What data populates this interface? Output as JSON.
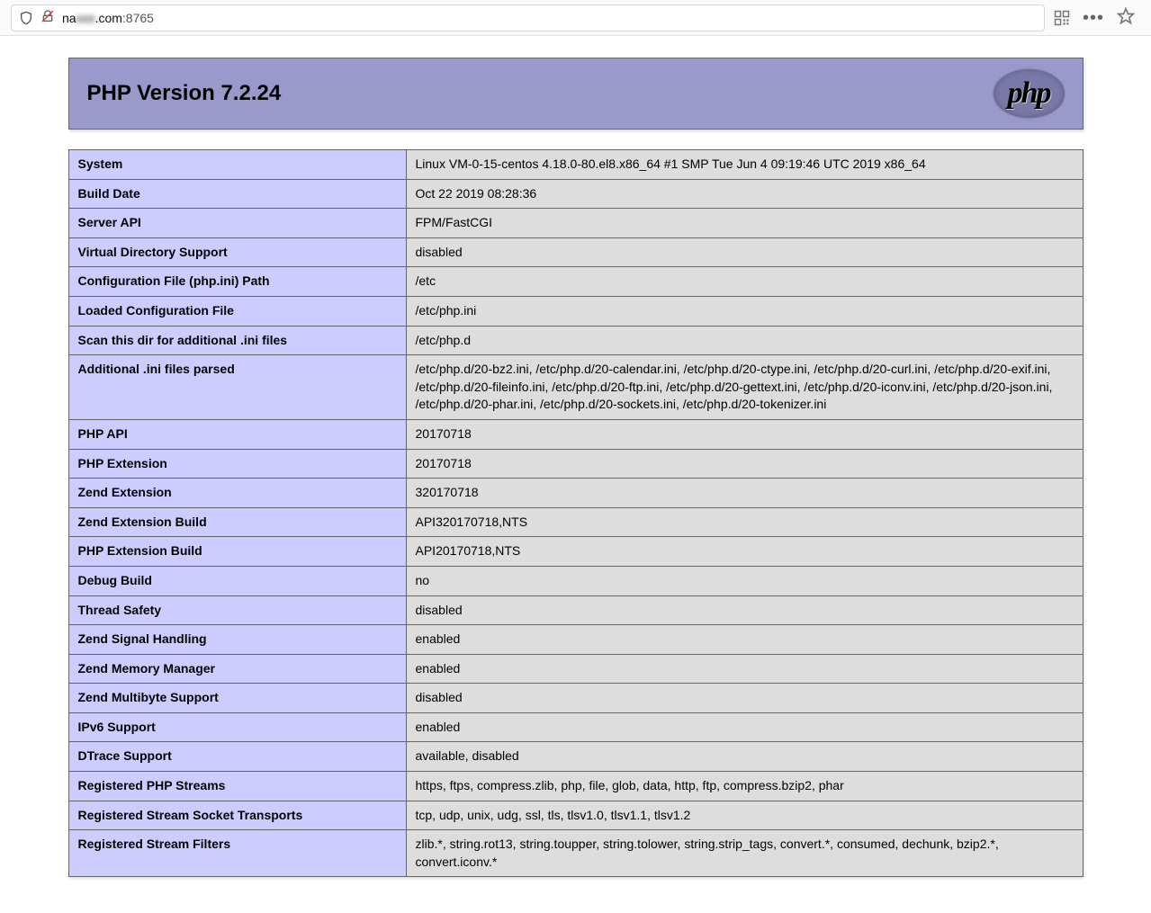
{
  "browser": {
    "url_prefix": "na",
    "url_blurred": "xxx",
    "url_domain_suffix": ".com",
    "url_port": ":8765"
  },
  "phpinfo": {
    "title": "PHP Version 7.2.24",
    "logo_text": "php",
    "rows": [
      {
        "label": "System",
        "value": "Linux VM-0-15-centos 4.18.0-80.el8.x86_64 #1 SMP Tue Jun 4 09:19:46 UTC 2019 x86_64"
      },
      {
        "label": "Build Date",
        "value": "Oct 22 2019 08:28:36"
      },
      {
        "label": "Server API",
        "value": "FPM/FastCGI"
      },
      {
        "label": "Virtual Directory Support",
        "value": "disabled"
      },
      {
        "label": "Configuration File (php.ini) Path",
        "value": "/etc"
      },
      {
        "label": "Loaded Configuration File",
        "value": "/etc/php.ini"
      },
      {
        "label": "Scan this dir for additional .ini files",
        "value": "/etc/php.d"
      },
      {
        "label": "Additional .ini files parsed",
        "value": "/etc/php.d/20-bz2.ini, /etc/php.d/20-calendar.ini, /etc/php.d/20-ctype.ini, /etc/php.d/20-curl.ini, /etc/php.d/20-exif.ini, /etc/php.d/20-fileinfo.ini, /etc/php.d/20-ftp.ini, /etc/php.d/20-gettext.ini, /etc/php.d/20-iconv.ini, /etc/php.d/20-json.ini, /etc/php.d/20-phar.ini, /etc/php.d/20-sockets.ini, /etc/php.d/20-tokenizer.ini"
      },
      {
        "label": "PHP API",
        "value": "20170718"
      },
      {
        "label": "PHP Extension",
        "value": "20170718"
      },
      {
        "label": "Zend Extension",
        "value": "320170718"
      },
      {
        "label": "Zend Extension Build",
        "value": "API320170718,NTS"
      },
      {
        "label": "PHP Extension Build",
        "value": "API20170718,NTS"
      },
      {
        "label": "Debug Build",
        "value": "no"
      },
      {
        "label": "Thread Safety",
        "value": "disabled"
      },
      {
        "label": "Zend Signal Handling",
        "value": "enabled"
      },
      {
        "label": "Zend Memory Manager",
        "value": "enabled"
      },
      {
        "label": "Zend Multibyte Support",
        "value": "disabled"
      },
      {
        "label": "IPv6 Support",
        "value": "enabled"
      },
      {
        "label": "DTrace Support",
        "value": "available, disabled"
      },
      {
        "label": "Registered PHP Streams",
        "value": "https, ftps, compress.zlib, php, file, glob, data, http, ftp, compress.bzip2, phar"
      },
      {
        "label": "Registered Stream Socket Transports",
        "value": "tcp, udp, unix, udg, ssl, tls, tlsv1.0, tlsv1.1, tlsv1.2"
      },
      {
        "label": "Registered Stream Filters",
        "value": "zlib.*, string.rot13, string.toupper, string.tolower, string.strip_tags, convert.*, consumed, dechunk, bzip2.*, convert.iconv.*"
      }
    ]
  }
}
